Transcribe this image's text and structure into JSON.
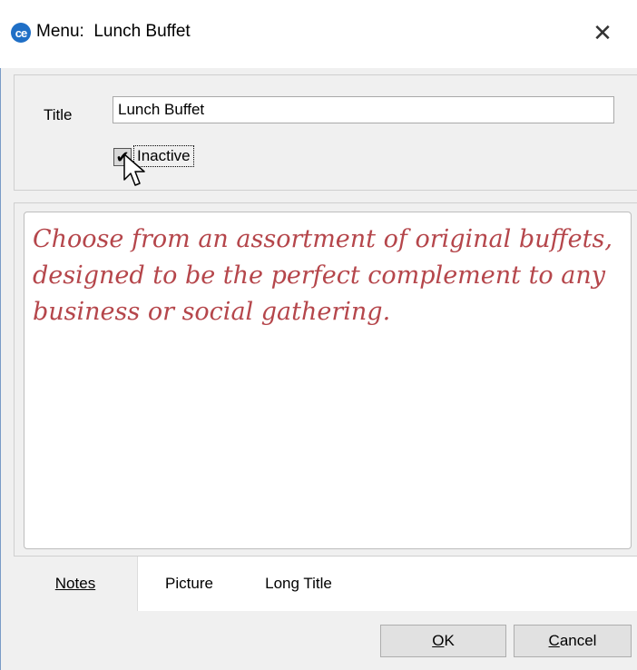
{
  "window": {
    "title": "Menu:  Lunch Buffet",
    "app_icon_glyph": "ce",
    "close_glyph": "✕"
  },
  "form": {
    "title_label": "Title",
    "title_value": "Lunch Buffet",
    "inactive_label": "Inactive",
    "inactive_checked": true,
    "check_glyph": "✔"
  },
  "notes": {
    "text": "Choose from an assortment of original buffets, designed to be the perfect complement to any business or social gathering."
  },
  "tabs": [
    {
      "label": "Notes",
      "active": true
    },
    {
      "label": "Picture",
      "active": false
    },
    {
      "label": "Long Title",
      "active": false
    }
  ],
  "buttons": {
    "ok_mnemonic": "O",
    "ok_rest": "K",
    "cancel_mnemonic": "C",
    "cancel_rest": "ancel"
  },
  "colors": {
    "notes_text": "#b5464b",
    "app_icon": "#1f6fc6"
  },
  "icons": {
    "app": "app-logo-icon",
    "close": "close-icon",
    "cursor": "mouse-pointer-icon",
    "check": "checkmark-icon"
  }
}
